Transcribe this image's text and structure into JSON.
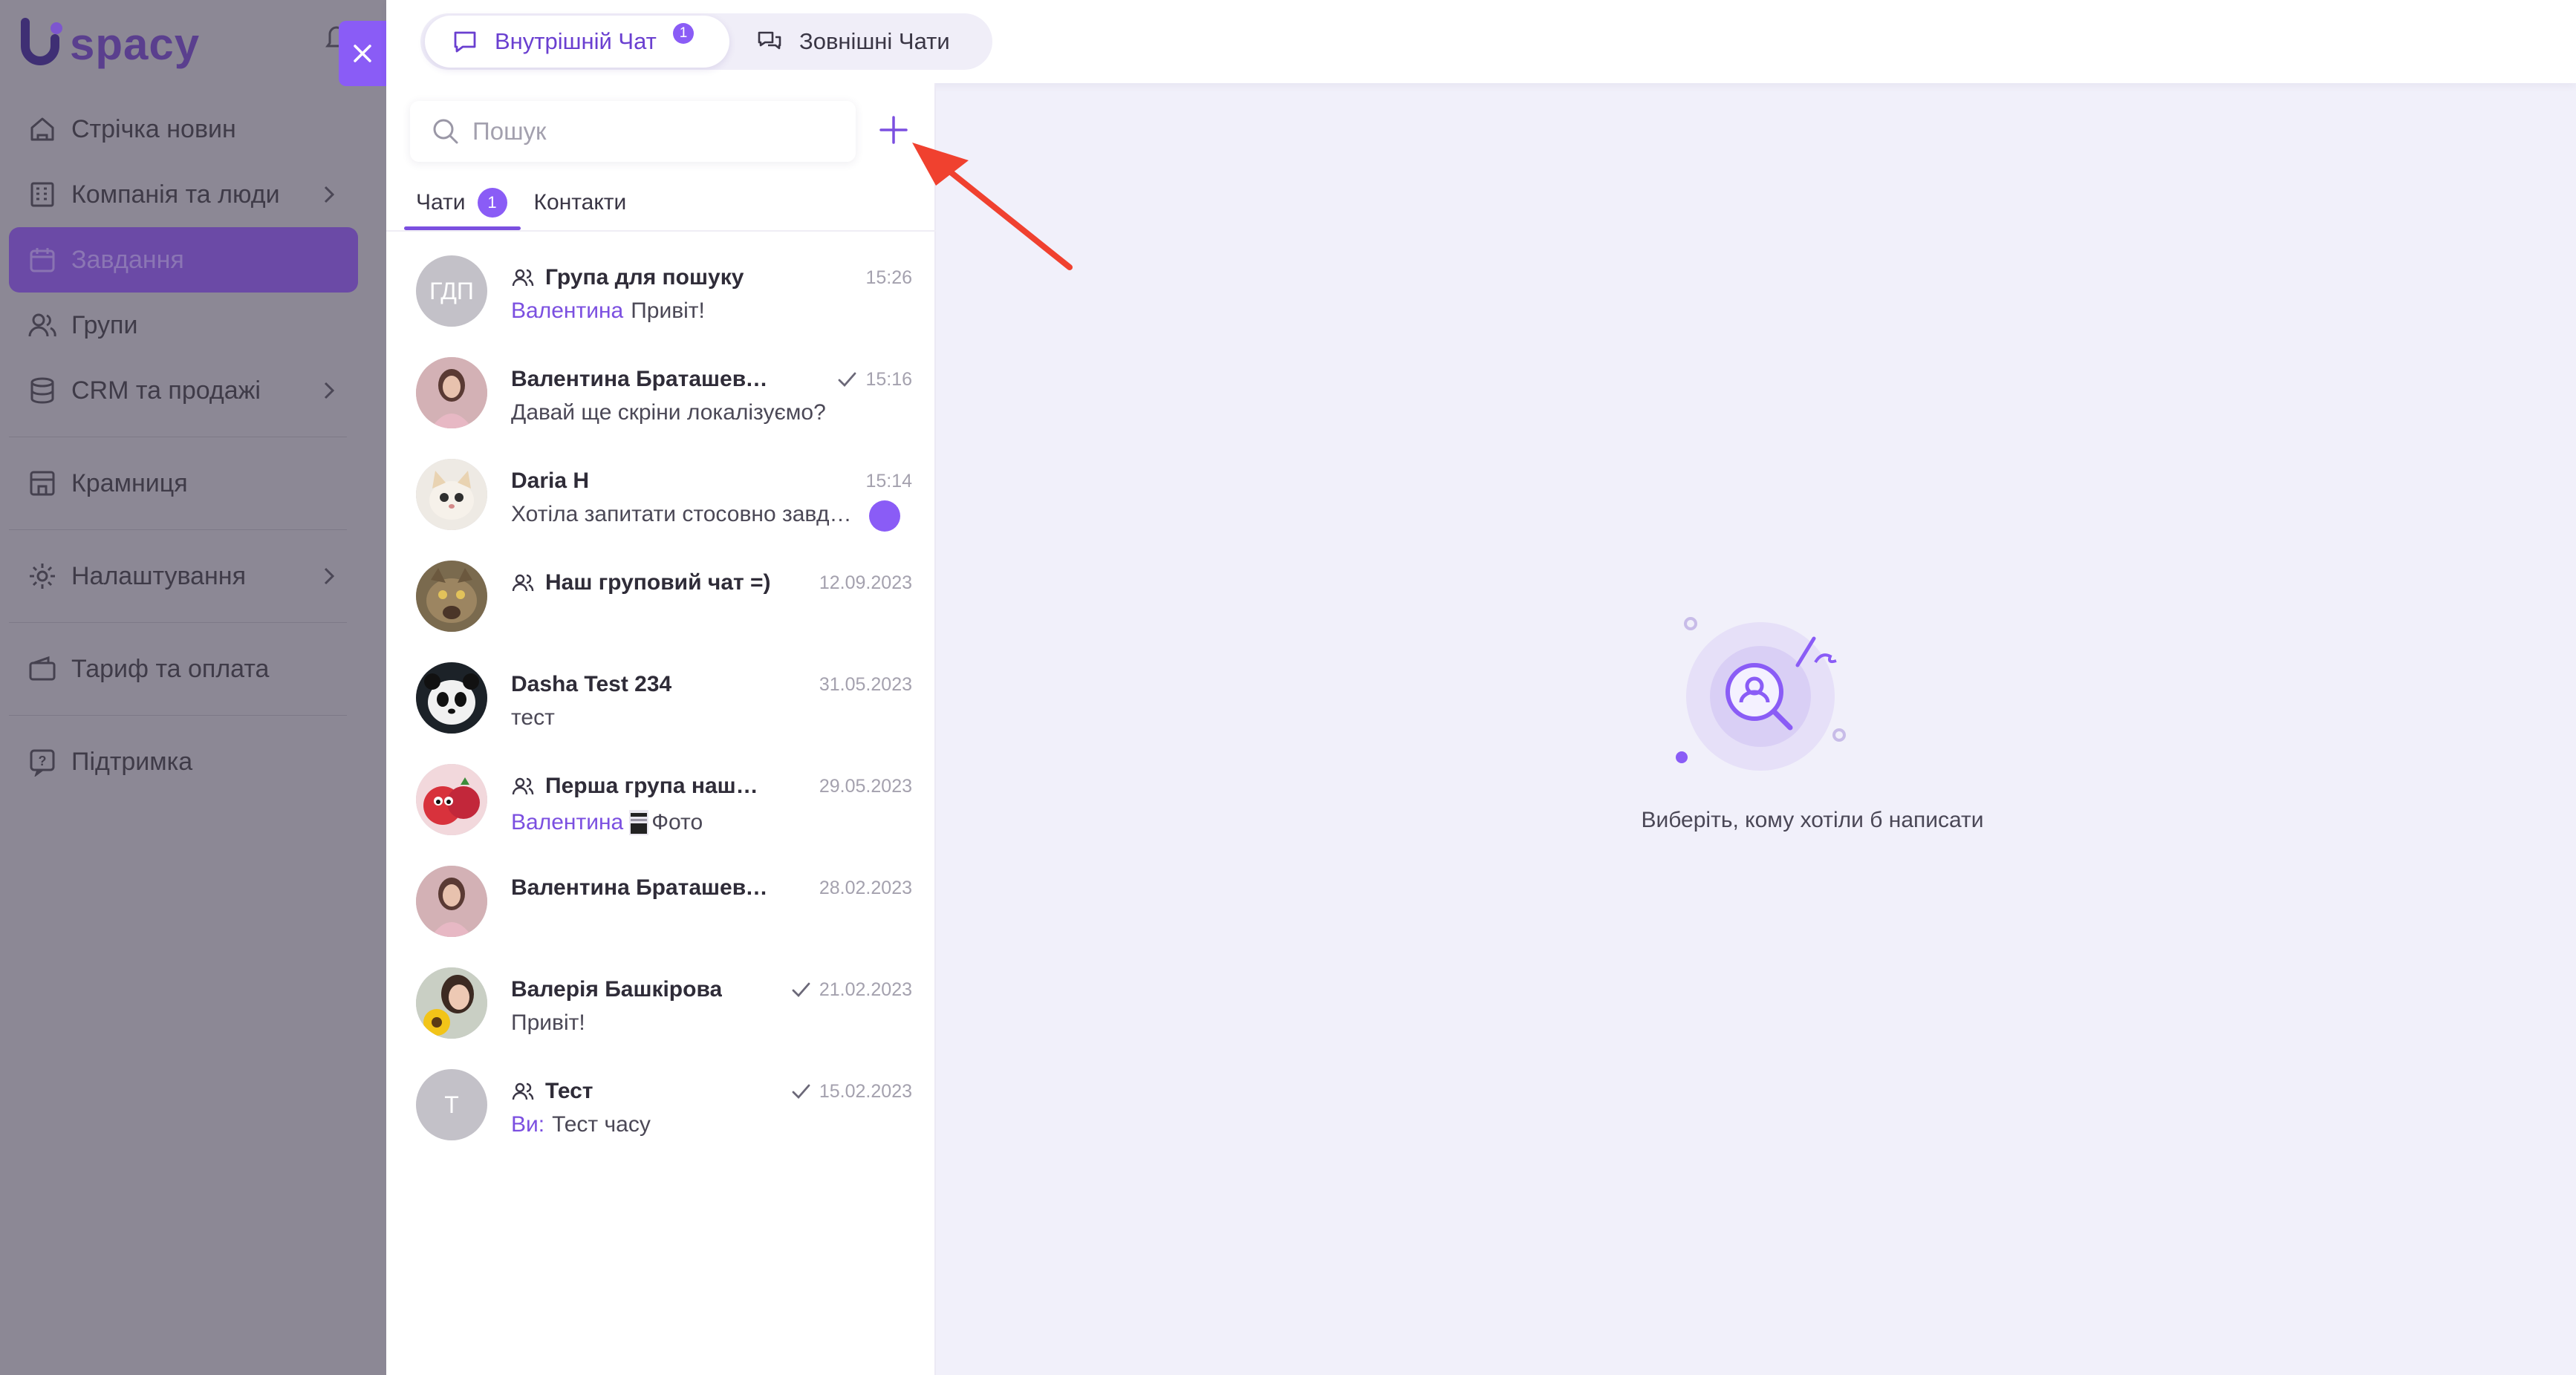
{
  "app": {
    "logo_text": "spacy"
  },
  "sidebar": {
    "items": [
      {
        "label": "Стрічка новин",
        "icon": "home-icon"
      },
      {
        "label": "Компанія та люди",
        "icon": "building-icon"
      },
      {
        "label": "Завдання",
        "icon": "calendar-icon"
      },
      {
        "label": "Групи",
        "icon": "users-icon"
      },
      {
        "label": "CRM та продажі",
        "icon": "database-icon"
      },
      {
        "label": "Крамниця",
        "icon": "store-icon"
      },
      {
        "label": "Налаштування",
        "icon": "gear-icon"
      },
      {
        "label": "Тариф та оплата",
        "icon": "wallet-icon"
      },
      {
        "label": "Підтримка",
        "icon": "help-icon"
      }
    ]
  },
  "top_tabs": [
    {
      "label": "Внутрішній Чат",
      "badge": "1"
    },
    {
      "label": "Зовнішні Чати"
    }
  ],
  "search": {
    "placeholder": "Пошук"
  },
  "list_tabs": [
    {
      "label": "Чати",
      "count": "1"
    },
    {
      "label": "Контакти"
    }
  ],
  "chats": [
    {
      "initials": "ГДП",
      "name": "Група для пошуку",
      "time": "15:26",
      "sender": "Валентина",
      "text": "Привіт!",
      "group": true,
      "read": false
    },
    {
      "name": "Валентина Браташевська",
      "time": "15:16",
      "text": "Давай ще скріни локалізуємо?",
      "group": false,
      "read": true
    },
    {
      "name": "Daria H",
      "time": "15:14",
      "text": "Хотіла запитати стосовно завдання",
      "group": false,
      "read": false,
      "unread": true
    },
    {
      "name": "Наш груповий чат =)",
      "time": "12.09.2023",
      "text": "",
      "group": true,
      "read": false
    },
    {
      "name": "Dasha Test 234",
      "time": "31.05.2023",
      "text": "тест",
      "group": false,
      "read": false
    },
    {
      "name": "Перша група нашого офісу",
      "time": "29.05.2023",
      "sender": "Валентина",
      "text": "Фото",
      "group": true,
      "read": false,
      "photo": true
    },
    {
      "name": "Валентина Браташевська",
      "time": "28.02.2023",
      "text": "",
      "group": false,
      "read": false
    },
    {
      "name": "Валерія Башкірова",
      "time": "21.02.2023",
      "text": "Привіт!",
      "group": false,
      "read": true
    },
    {
      "initials": "Т",
      "name": "Тест",
      "time": "15.02.2023",
      "sender": "Ви:",
      "text": "Тест часу",
      "group": true,
      "read": true
    }
  ],
  "empty_state": {
    "text": "Виберіть, кому хотіли б написати"
  },
  "colors": {
    "accent": "#8a5cf6",
    "accent_dark": "#6a3fd0",
    "annotation_arrow": "#f0412f"
  }
}
